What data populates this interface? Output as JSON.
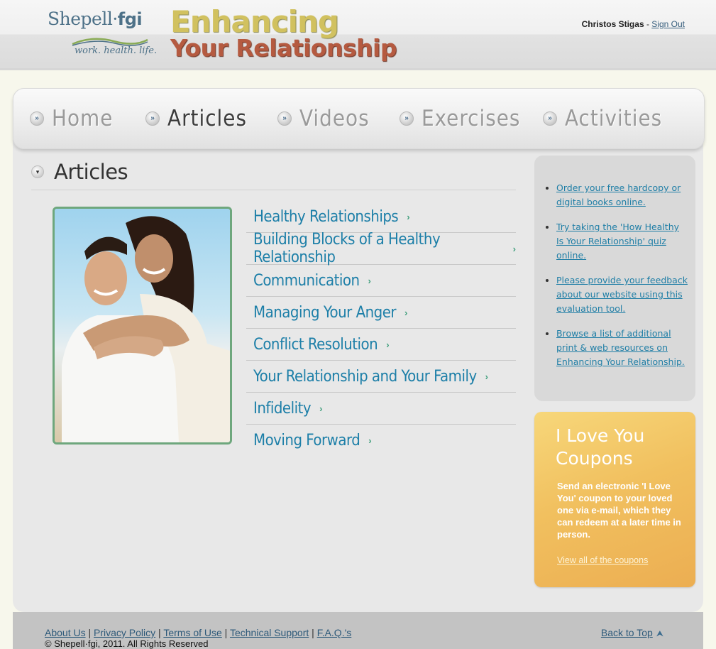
{
  "header": {
    "logo_name": "Shepell",
    "logo_suffix": "fgi",
    "logo_tagline": "work. health. life.",
    "title_line1": "Enhancing",
    "title_line2": "Your Relationship",
    "user_name": "Christos Stigas",
    "separator": " - ",
    "sign_out": "Sign Out"
  },
  "nav": {
    "items": [
      {
        "label": "Home"
      },
      {
        "label": "Articles"
      },
      {
        "label": "Videos"
      },
      {
        "label": "Exercises"
      },
      {
        "label": "Activities"
      }
    ],
    "active": "Articles"
  },
  "section": {
    "title": "Articles"
  },
  "articles": [
    {
      "label": "Healthy Relationships"
    },
    {
      "label": "Building Blocks of a Healthy Relationship"
    },
    {
      "label": "Communication"
    },
    {
      "label": "Managing Your Anger"
    },
    {
      "label": "Conflict Resolution"
    },
    {
      "label": "Your Relationship and Your Family"
    },
    {
      "label": "Infidelity"
    },
    {
      "label": "Moving Forward"
    }
  ],
  "sidebar": {
    "links": [
      {
        "label": "Order your free hardcopy or digital books online."
      },
      {
        "label": "Try taking the 'How Healthy Is Your Relationship' quiz online."
      },
      {
        "label": "Please provide your feedback about our website using this evaluation tool."
      },
      {
        "label": "Browse a list of additional print & web resources on Enhancing Your Relationship."
      }
    ]
  },
  "coupon": {
    "title": "I Love You Coupons",
    "text": "Send an electronic 'I Love You' coupon to your loved one via e-mail, which they can redeem at a later time in person.",
    "link": "View all of the coupons"
  },
  "footer": {
    "links": [
      {
        "label": "About Us"
      },
      {
        "label": "Privacy Policy"
      },
      {
        "label": "Terms of Use"
      },
      {
        "label": "Technical Support"
      },
      {
        "label": "F.A.Q.'s"
      }
    ],
    "copyright": "© Shepell·fgi, 2011. All Rights Reserved",
    "back_to_top": "Back to Top"
  },
  "colors": {
    "link_blue": "#1d7fa8",
    "arrow_green": "#43a07e",
    "coupon_orange": "#f1c05f",
    "photo_border": "#6ea77d"
  }
}
